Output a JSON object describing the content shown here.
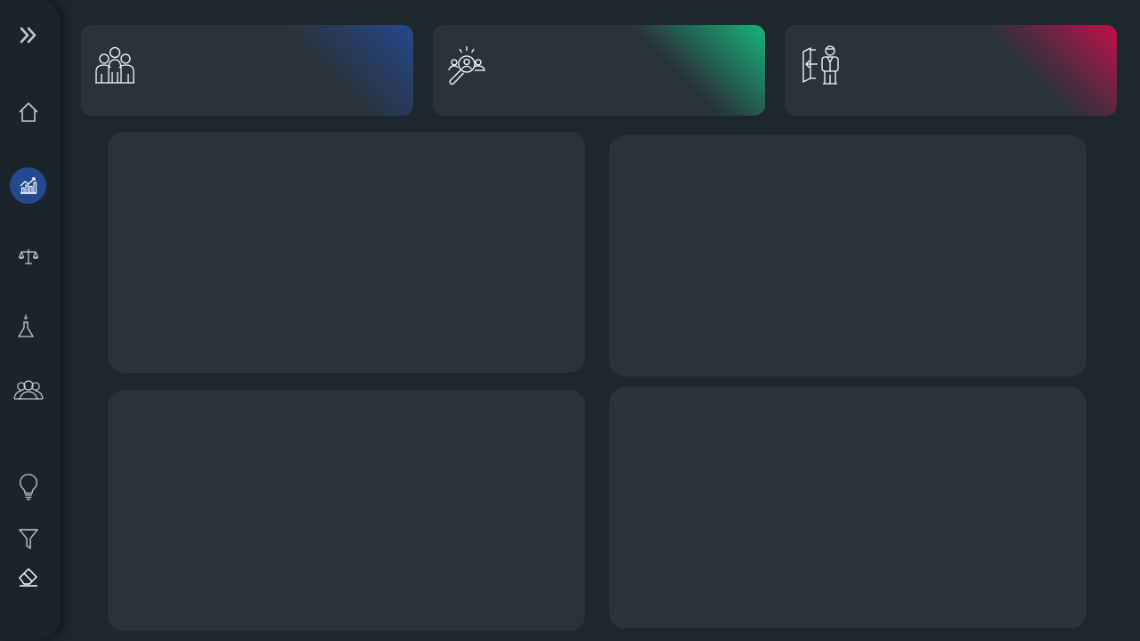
{
  "sidebar": {
    "items": [
      {
        "icon": "expand-chevrons-icon"
      },
      {
        "icon": "home-icon"
      },
      {
        "icon": "analytics-chart-icon",
        "active": true
      },
      {
        "icon": "balance-scale-icon"
      },
      {
        "icon": "lab-flask-icon"
      },
      {
        "icon": "people-group-icon"
      },
      {
        "icon": "lightbulb-icon"
      },
      {
        "icon": "filter-icon"
      },
      {
        "icon": "eraser-icon"
      }
    ]
  },
  "kpi_cards": [
    {
      "icon": "team-icon",
      "accent": "#24498f"
    },
    {
      "icon": "talent-search-icon",
      "accent": "#16b67a"
    },
    {
      "icon": "employee-exit-icon",
      "accent": "#c2104a"
    }
  ],
  "colors": {
    "background": "#1e262e",
    "sidebar": "#1b232b",
    "card": "#29333b",
    "active": "#24498f"
  }
}
